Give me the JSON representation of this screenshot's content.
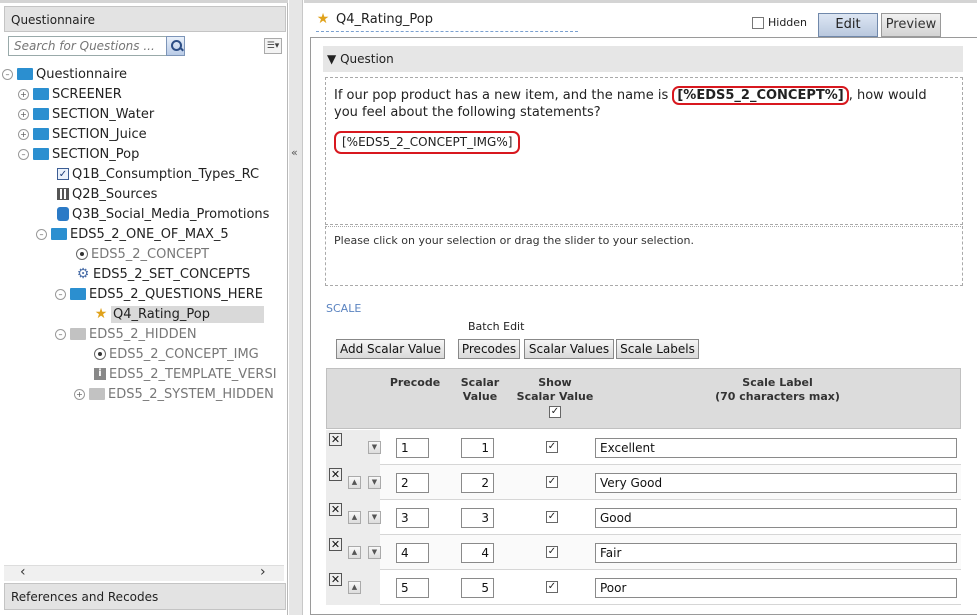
{
  "left": {
    "header": "Questionnaire",
    "search_placeholder": "Search for Questions ...",
    "tree": [
      {
        "label": "Questionnaire"
      },
      {
        "label": "SCREENER"
      },
      {
        "label": "SECTION_Water"
      },
      {
        "label": "SECTION_Juice"
      },
      {
        "label": "SECTION_Pop"
      },
      {
        "label": "Q1B_Consumption_Types_RC"
      },
      {
        "label": "Q2B_Sources"
      },
      {
        "label": "Q3B_Social_Media_Promotions"
      },
      {
        "label": "EDS5_2_ONE_OF_MAX_5"
      },
      {
        "label": "EDS5_2_CONCEPT"
      },
      {
        "label": "EDS5_2_SET_CONCEPTS"
      },
      {
        "label": "EDS5_2_QUESTIONS_HERE"
      },
      {
        "label": "Q4_Rating_Pop"
      },
      {
        "label": "EDS5_2_HIDDEN"
      },
      {
        "label": "EDS5_2_CONCEPT_IMG"
      },
      {
        "label": "EDS5_2_TEMPLATE_VERSI"
      },
      {
        "label": "EDS5_2_SYSTEM_HIDDEN"
      }
    ],
    "footer": "References and Recodes"
  },
  "right": {
    "question_name": "Q4_Rating_Pop",
    "hidden_label": "Hidden",
    "tabs": {
      "edit": "Edit",
      "preview": "Preview"
    },
    "section_header": "Question",
    "question_text_before": "If our pop product has a new item, and the name is ",
    "concept_token": "[%EDS5_2_CONCEPT%]",
    "question_text_after": ", how would you feel about the following statements?",
    "img_token": "[%EDS5_2_CONCEPT_IMG%]",
    "instructions": "Please click on your selection or drag the slider to your selection.",
    "scale_label": "SCALE",
    "batch_edit_label": "Batch Edit",
    "buttons": {
      "add_scalar": "Add Scalar Value",
      "precodes": "Precodes",
      "scalar_values": "Scalar Values",
      "scale_labels": "Scale Labels"
    },
    "columns": {
      "precode": "Precode",
      "scalar_value": "Scalar Value",
      "show_scalar_line1": "Show",
      "show_scalar_line2": "Scalar Value",
      "scale_label_line1": "Scale Label",
      "scale_label_line2": "(70 characters max)"
    },
    "check_mark": "✓",
    "rows": [
      {
        "precode": "1",
        "scalar": "1",
        "label": "Excellent"
      },
      {
        "precode": "2",
        "scalar": "2",
        "label": "Very Good"
      },
      {
        "precode": "3",
        "scalar": "3",
        "label": "Good"
      },
      {
        "precode": "4",
        "scalar": "4",
        "label": "Fair"
      },
      {
        "precode": "5",
        "scalar": "5",
        "label": "Poor"
      }
    ]
  }
}
